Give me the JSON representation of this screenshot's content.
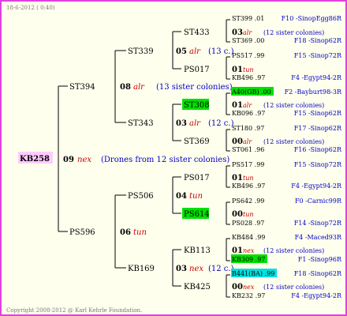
{
  "header": {
    "date": "18-6-2012 ( 0:40)"
  },
  "footer": {
    "copyright": "Copyright 2008-2012 @ Karl Kehrle Foundation."
  },
  "colors": {
    "border": "#e040e0",
    "green": "#00e000",
    "cyan": "#00e0e0",
    "name": "#0000c8",
    "red": "#cc0000"
  },
  "subject": {
    "id": "KB258",
    "num": "09",
    "tag": "nex",
    "note": "(Drones from 12 sister colonies)"
  },
  "gen1": [
    {
      "id": "ST394",
      "num": "08",
      "tag": "alr",
      "note": "(13 sister colonies)"
    },
    {
      "id": "PS596",
      "num": "06",
      "tag": "tun",
      "note": ""
    }
  ],
  "gen2": [
    {
      "id": "ST339",
      "num": "05",
      "tag": "alr",
      "note": "(13 c.)"
    },
    {
      "id": "ST343",
      "num": "03",
      "tag": "alr",
      "note": "(12 c.)"
    },
    {
      "id": "PS506",
      "num": "04",
      "tag": "tun",
      "note": ""
    },
    {
      "id": "KB169",
      "num": "03",
      "tag": "nex",
      "note": "(12 c.)"
    }
  ],
  "gen3": [
    {
      "id": "ST433",
      "hl": ""
    },
    {
      "id": "PS017",
      "hl": ""
    },
    {
      "id": "ST308",
      "hl": "green"
    },
    {
      "id": "ST369",
      "hl": ""
    },
    {
      "id": "PS017",
      "hl": ""
    },
    {
      "id": "PS614",
      "hl": "green"
    },
    {
      "id": "KB113",
      "hl": ""
    },
    {
      "id": "KB425",
      "hl": ""
    }
  ],
  "gen4": [
    {
      "ids": "ST399 .01",
      "hl": "",
      "num": "03",
      "tag": "alr",
      "note": "(12 sister colonies)",
      "sire_ids": "ST369 .00",
      "origin1": "F10 -SinopEgg86R",
      "origin2": "F18 -Sinop62R"
    },
    {
      "ids": "PS517 .99",
      "hl": "",
      "num": "01",
      "tag": "tun",
      "note": "",
      "sire_ids": "KB496 .97",
      "origin1": "F15 -Sinop72R",
      "origin2": "F4 -Egypt94-2R"
    },
    {
      "ids": "A40(GB) .00",
      "hl": "green",
      "num": "01",
      "tag": "alr",
      "note": "(12 sister colonies)",
      "sire_ids": "KB096 .97",
      "origin1": "F2 -Bayburt98-3R",
      "origin2": "F15 -Sinop62R"
    },
    {
      "ids": "ST180 .97",
      "hl": "",
      "num": "00",
      "tag": "alr",
      "note": "(12 sister colonies)",
      "sire_ids": "ST061 .96",
      "origin1": "F17 -Sinop62R",
      "origin2": "F16 -Sinop62R"
    },
    {
      "ids": "PS517 .99",
      "hl": "",
      "num": "01",
      "tag": "tun",
      "note": "",
      "sire_ids": "KB496 .97",
      "origin1": "F15 -Sinop72R",
      "origin2": "F4 -Egypt94-2R"
    },
    {
      "ids": "PS642 .99",
      "hl": "",
      "num": "00",
      "tag": "tun",
      "note": "",
      "sire_ids": "PS028 .97",
      "origin1": "F0 -Carnic99R",
      "origin2": "F14 -Sinop72R"
    },
    {
      "ids": "KB484 .99",
      "hl": "",
      "num": "01",
      "tag": "nex",
      "note": "(12 sister colonies)",
      "sire_ids": "KB309 .97",
      "sire_hl": "green",
      "origin1": "F4 -Maced93R",
      "origin2": "F1 -Sinop96R"
    },
    {
      "ids": "B441(BA) .99",
      "hl": "cyan",
      "num": "00",
      "tag": "nex",
      "note": "(12 sister colonies)",
      "sire_ids": "KB232 .97",
      "origin1": "F18 -Sinop62R",
      "origin2": "F4 -Egypt94-2R"
    }
  ]
}
